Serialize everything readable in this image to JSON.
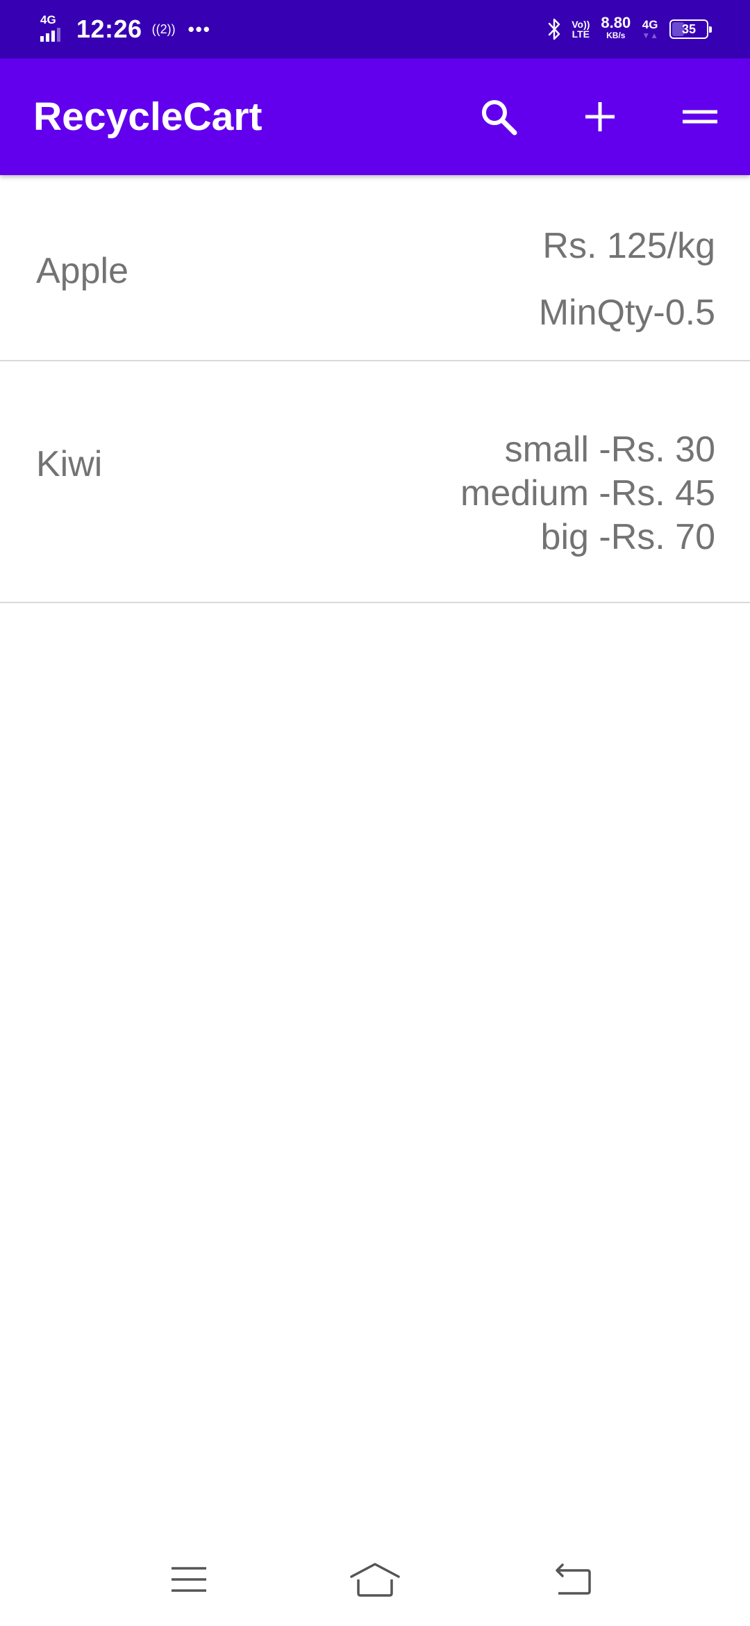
{
  "status_bar": {
    "network_left": "4G",
    "time": "12:26",
    "hotspot_label": "((2))",
    "more_indicator": "•••",
    "volte_top": "Vo))",
    "volte_bottom": "LTE",
    "speed_value": "8.80",
    "speed_unit": "KB/s",
    "network_right": "4G",
    "network_right_arrows": "▼▲",
    "battery_level": "35",
    "battery_fraction": 0.35,
    "icons": [
      "signal-icon",
      "hotspot-icon",
      "bluetooth-icon",
      "battery-icon"
    ]
  },
  "app_bar": {
    "title": "RecycleCart",
    "actions": [
      "search-icon",
      "add-icon",
      "menu-icon"
    ]
  },
  "items": [
    {
      "name": "Apple",
      "details": [
        "Rs. 125/kg",
        "MinQty-0.5"
      ]
    },
    {
      "name": "Kiwi",
      "details": [
        "small -Rs. 30",
        "medium -Rs. 45",
        "big -Rs. 70"
      ]
    }
  ],
  "nav_bar": {
    "buttons": [
      "recents-icon",
      "home-icon",
      "back-icon"
    ]
  },
  "colors": {
    "status_bar": "#3700b3",
    "app_bar": "#6200ee",
    "item_text": "#737373",
    "divider": "#d9d9d9",
    "nav_icon": "#555555"
  }
}
